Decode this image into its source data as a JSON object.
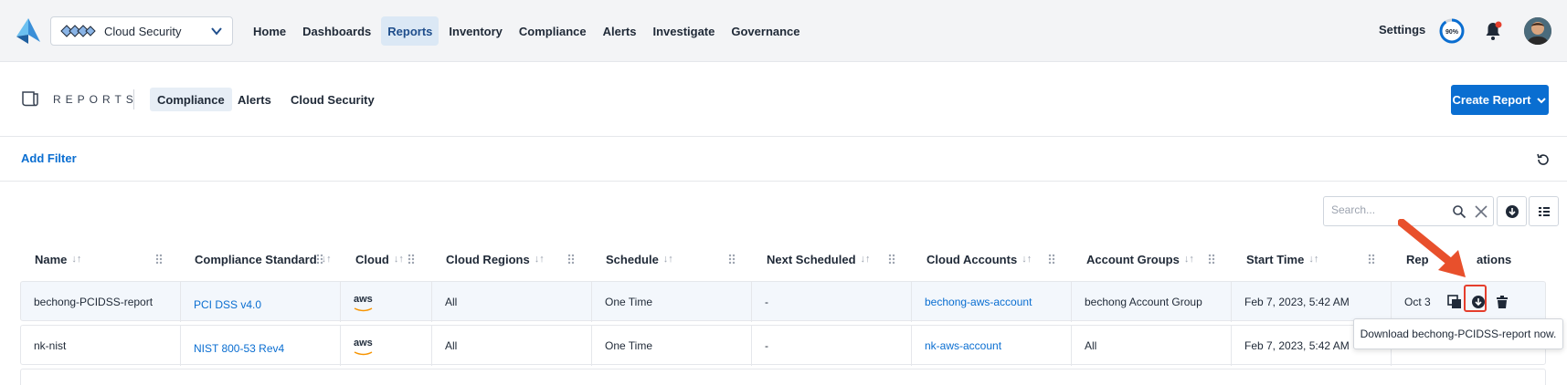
{
  "topbar": {
    "tenant": "Cloud Security",
    "nav": [
      "Home",
      "Dashboards",
      "Reports",
      "Inventory",
      "Compliance",
      "Alerts",
      "Investigate",
      "Governance"
    ],
    "active_nav": "Reports",
    "settings": "Settings",
    "progress_label": "90%",
    "progress_value": 0.9,
    "notification_dot_color": "#e53e2c"
  },
  "reports": {
    "title": "REPORTS",
    "tabs": [
      "Compliance",
      "Alerts",
      "Cloud Security"
    ],
    "active_tab": "Compliance",
    "create_button": "Create Report"
  },
  "filters": {
    "add_filter": "Add Filter"
  },
  "search": {
    "placeholder": "Search..."
  },
  "table": {
    "columns": [
      "Name",
      "Compliance Standard",
      "Cloud",
      "Cloud Regions",
      "Schedule",
      "Next Scheduled",
      "Cloud Accounts",
      "Account Groups",
      "Start Time",
      "Rep",
      "ations"
    ],
    "rows": [
      {
        "name": "bechong-PCIDSS-report",
        "standard": "PCI DSS v4.0",
        "cloud": "aws",
        "regions": "All",
        "schedule": "One Time",
        "next": "-",
        "accounts": "bechong-aws-account",
        "groups": "bechong Account Group",
        "start": "Feb 7, 2023, 5:42 AM",
        "report": "Oct 3"
      },
      {
        "name": "nk-nist",
        "standard": "NIST 800-53 Rev4",
        "cloud": "aws",
        "regions": "All",
        "schedule": "One Time",
        "next": "-",
        "accounts": "nk-aws-account",
        "groups": "All",
        "start": "Feb 7, 2023, 5:42 AM",
        "report": ""
      }
    ]
  },
  "tooltip": "Download bechong-PCIDSS-report now.",
  "colors": {
    "primary": "#0a6ed1",
    "highlight": "#e53e2c"
  }
}
